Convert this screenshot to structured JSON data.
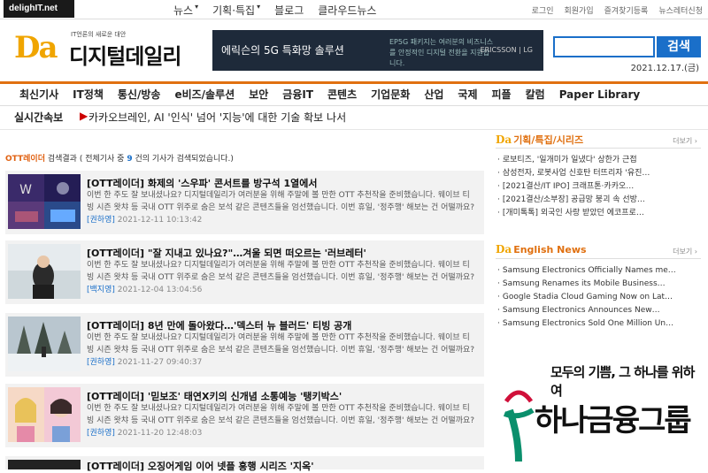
{
  "header": {
    "site_badge": "delighIT.net",
    "topnav": [
      "뉴스",
      "기획·특집",
      "블로그",
      "클라우드뉴스"
    ],
    "toplinks": [
      "로그인",
      "회원가입",
      "즐겨찾기등록",
      "뉴스레터신청"
    ],
    "logo": {
      "mark": "Da",
      "tagline": "IT언론의 새로운 대안",
      "name": "디지털데일리"
    },
    "banner": {
      "text": "에릭슨의 5G 특화망 솔루션",
      "sub": "EP5G 패키지는 여러분의 비즈니스를 안정적인 디지털 전환을 지원합니다.",
      "logos": "ERICSSON | LG"
    },
    "search_button": "검색",
    "search_placeholder": "",
    "date": "2021.12.17.(금)"
  },
  "mainnav": [
    "최신기사",
    "IT정책",
    "통신/방송",
    "e비즈/솔루션",
    "보안",
    "금융IT",
    "콘텐츠",
    "기업문화",
    "산업",
    "국제",
    "피플",
    "칼럼",
    "Paper Library"
  ],
  "ticker": {
    "label": "실시간속보",
    "text": "카카오브레인, AI '인식' 넘어 '지능'에 대한 기술 확보 나서"
  },
  "results": {
    "keyword": "OTT레이더",
    "summary_mid": " 검색결과 ( 전체기사 중 ",
    "count": "9",
    "summary_end": " 건의 기사가 검색되었습니다.)"
  },
  "articles": [
    {
      "title": "[OTT레이더] 화제의 '스우파' 콘서트를 방구석 1열에서",
      "body": "이번 한 주도 잘 보내셨나요? 디지털데일리가 여러분을 위해 주말에 볼 만한 OTT 추천작을 준비했습니다. 웨이브 티빙 시즌 왓챠 등 국내 OTT 위주로 숨은 보석 같은 콘텐츠들을 엄선했습니다. 이번 휴일, '정주행' 해보는 건 어떨까요?",
      "reporter": "[권하영]",
      "date": "2021-12-11 10:13:42"
    },
    {
      "title": "[OTT레이더] \"잘 지내고 있나요?\"…겨울 되면 떠오르는 '러브레터'",
      "body": "이번 한 주도 잘 보내셨나요? 디지털데일리가 여러분을 위해 주말에 볼 만한 OTT 추천작을 준비했습니다. 웨이브 티빙 시즌 왓챠 등 국내 OTT 위주로 숨은 보석 같은 콘텐츠들을 엄선했습니다. 이번 휴일, '정주행' 해보는 건 어떨까요?",
      "reporter": "[백지영]",
      "date": "2021-12-04 13:04:56"
    },
    {
      "title": "[OTT레이더] 8년 만에 돌아왔다…'덱스터 뉴 블러드' 티빙 공개",
      "body": "이번 한 주도 잘 보내셨나요? 디지털데일리가 여러분을 위해 주말에 볼 만한 OTT 추천작을 준비했습니다. 웨이브 티빙 시즌 왓챠 등 국내 OTT 위주로 숨은 보석 같은 콘텐츠들을 엄선했습니다. 이번 휴일, '정주행' 해보는 건 어떨까요?",
      "reporter": "[권하영]",
      "date": "2021-11-27 09:40:37"
    },
    {
      "title": "[OTT레이더] '믿보조' 태연X키의 신개념 소통예능 '탱키박스'",
      "body": "이번 한 주도 잘 보내셨나요? 디지털데일리가 여러분을 위해 주말에 볼 만한 OTT 추천작을 준비했습니다. 웨이브 티빙 시즌 왓챠 등 국내 OTT 위주로 숨은 보석 같은 콘텐츠들을 엄선했습니다. 이번 휴일, '정주행' 해보는 건 어떨까요?",
      "reporter": "[권하영]",
      "date": "2021-11-20 12:48:03"
    },
    {
      "title": "[OTT레이더] 오징어게임 이어 넷플 흥행 시리즈 '지옥'",
      "body": "",
      "reporter": "",
      "date": ""
    }
  ],
  "sidebar": {
    "features": {
      "title": "기획/특집/시리즈",
      "more": "더보기 ›",
      "items": [
        "로보티즈, '일개미가 일냈다' 상한가 근접",
        "삼성전자, 로봇사업 신호탄 터뜨리자 '유진…",
        "[2021결산/IT IPO] 크래프톤·카카오…",
        "[2021결산/소부장] 공급망 붕괴 속 선방…",
        "[개미톡톡] 외국인 사랑 받았던 에코프로…"
      ]
    },
    "english": {
      "title": "English News",
      "more": "더보기 ›",
      "items": [
        "Samsung Electronics Officially Names me…",
        "Samsung Renames its Mobile Business…",
        "Google Stadia Cloud Gaming Now on Lat…",
        "Samsung Electronics Announces New…",
        "Samsung Electronics Sold One Million Un…"
      ]
    },
    "ad": {
      "slogan": "모두의 기쁨, 그 하나를 위하여",
      "name": "하나금융그룹"
    }
  }
}
